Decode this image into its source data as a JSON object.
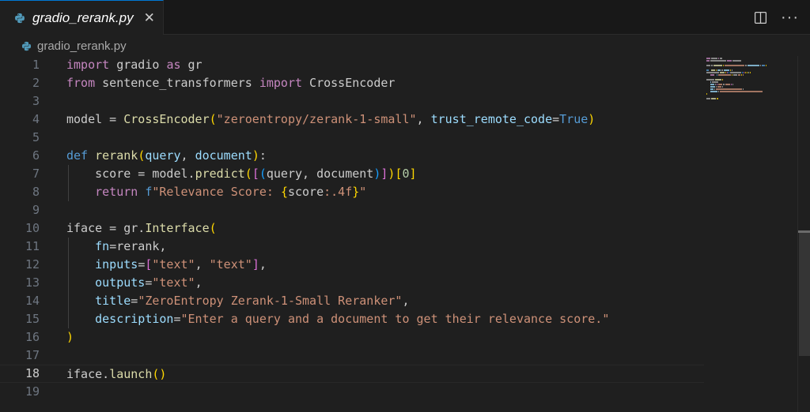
{
  "tab": {
    "filename": "gradio_rerank.py",
    "close": "✕",
    "icon": "python-icon"
  },
  "actions": {
    "split": "split-editor-icon",
    "more": "···"
  },
  "breadcrumb": {
    "filename": "gradio_rerank.py"
  },
  "editor": {
    "active_line": 18,
    "line_numbers": [
      "1",
      "2",
      "3",
      "4",
      "5",
      "6",
      "7",
      "8",
      "9",
      "10",
      "11",
      "12",
      "13",
      "14",
      "15",
      "16",
      "17",
      "18",
      "19"
    ],
    "lines": [
      [
        {
          "t": "import",
          "c": "kw"
        },
        {
          "t": " gradio ",
          "c": "plain"
        },
        {
          "t": "as",
          "c": "kw"
        },
        {
          "t": " gr",
          "c": "plain"
        }
      ],
      [
        {
          "t": "from",
          "c": "kw"
        },
        {
          "t": " sentence_transformers ",
          "c": "plain"
        },
        {
          "t": "import",
          "c": "kw"
        },
        {
          "t": " CrossEncoder",
          "c": "plain"
        }
      ],
      [],
      [
        {
          "t": "model",
          "c": "plain"
        },
        {
          "t": " = ",
          "c": "plain"
        },
        {
          "t": "CrossEncoder",
          "c": "fn"
        },
        {
          "t": "(",
          "c": "par"
        },
        {
          "t": "\"zeroentropy/zerank-1-small\"",
          "c": "str"
        },
        {
          "t": ", ",
          "c": "plain"
        },
        {
          "t": "trust_remote_code",
          "c": "var"
        },
        {
          "t": "=",
          "c": "plain"
        },
        {
          "t": "True",
          "c": "kw2"
        },
        {
          "t": ")",
          "c": "par"
        }
      ],
      [],
      [
        {
          "t": "def",
          "c": "kw2"
        },
        {
          "t": " ",
          "c": "plain"
        },
        {
          "t": "rerank",
          "c": "fn"
        },
        {
          "t": "(",
          "c": "par"
        },
        {
          "t": "query",
          "c": "var"
        },
        {
          "t": ", ",
          "c": "plain"
        },
        {
          "t": "document",
          "c": "var"
        },
        {
          "t": ")",
          "c": "par"
        },
        {
          "t": ":",
          "c": "plain"
        }
      ],
      [
        {
          "t": "    score = model.",
          "c": "plain"
        },
        {
          "t": "predict",
          "c": "fn"
        },
        {
          "t": "(",
          "c": "par"
        },
        {
          "t": "[",
          "c": "brk2"
        },
        {
          "t": "(",
          "c": "brk3"
        },
        {
          "t": "query, document",
          "c": "plain"
        },
        {
          "t": ")",
          "c": "brk3"
        },
        {
          "t": "]",
          "c": "brk2"
        },
        {
          "t": ")",
          "c": "par"
        },
        {
          "t": "[",
          "c": "par"
        },
        {
          "t": "0",
          "c": "num"
        },
        {
          "t": "]",
          "c": "par"
        }
      ],
      [
        {
          "t": "    ",
          "c": "plain"
        },
        {
          "t": "return",
          "c": "kw"
        },
        {
          "t": " ",
          "c": "plain"
        },
        {
          "t": "f",
          "c": "kw2"
        },
        {
          "t": "\"Relevance Score: ",
          "c": "str"
        },
        {
          "t": "{",
          "c": "par"
        },
        {
          "t": "score",
          "c": "plain"
        },
        {
          "t": ":.4f",
          "c": "str"
        },
        {
          "t": "}",
          "c": "par"
        },
        {
          "t": "\"",
          "c": "str"
        }
      ],
      [],
      [
        {
          "t": "iface = gr.",
          "c": "plain"
        },
        {
          "t": "Interface",
          "c": "fn"
        },
        {
          "t": "(",
          "c": "par"
        }
      ],
      [
        {
          "t": "    ",
          "c": "plain"
        },
        {
          "t": "fn",
          "c": "var"
        },
        {
          "t": "=rerank,",
          "c": "plain"
        }
      ],
      [
        {
          "t": "    ",
          "c": "plain"
        },
        {
          "t": "inputs",
          "c": "var"
        },
        {
          "t": "=",
          "c": "plain"
        },
        {
          "t": "[",
          "c": "brk2"
        },
        {
          "t": "\"text\"",
          "c": "str"
        },
        {
          "t": ", ",
          "c": "plain"
        },
        {
          "t": "\"text\"",
          "c": "str"
        },
        {
          "t": "]",
          "c": "brk2"
        },
        {
          "t": ",",
          "c": "plain"
        }
      ],
      [
        {
          "t": "    ",
          "c": "plain"
        },
        {
          "t": "outputs",
          "c": "var"
        },
        {
          "t": "=",
          "c": "plain"
        },
        {
          "t": "\"text\"",
          "c": "str"
        },
        {
          "t": ",",
          "c": "plain"
        }
      ],
      [
        {
          "t": "    ",
          "c": "plain"
        },
        {
          "t": "title",
          "c": "var"
        },
        {
          "t": "=",
          "c": "plain"
        },
        {
          "t": "\"ZeroEntropy Zerank-1-Small Reranker\"",
          "c": "str"
        },
        {
          "t": ",",
          "c": "plain"
        }
      ],
      [
        {
          "t": "    ",
          "c": "plain"
        },
        {
          "t": "description",
          "c": "var"
        },
        {
          "t": "=",
          "c": "plain"
        },
        {
          "t": "\"Enter a query and a document to get their relevance score.\"",
          "c": "str"
        }
      ],
      [
        {
          "t": ")",
          "c": "par"
        }
      ],
      [],
      [
        {
          "t": "iface.",
          "c": "plain"
        },
        {
          "t": "launch",
          "c": "fn"
        },
        {
          "t": "()",
          "c": "par"
        }
      ],
      []
    ]
  },
  "colors": {
    "background": "#1f1f1f",
    "tab_bar": "#181818",
    "accent": "#0078d4",
    "keyword": "#c586c0",
    "string": "#ce9178",
    "function": "#dcdcaa"
  }
}
